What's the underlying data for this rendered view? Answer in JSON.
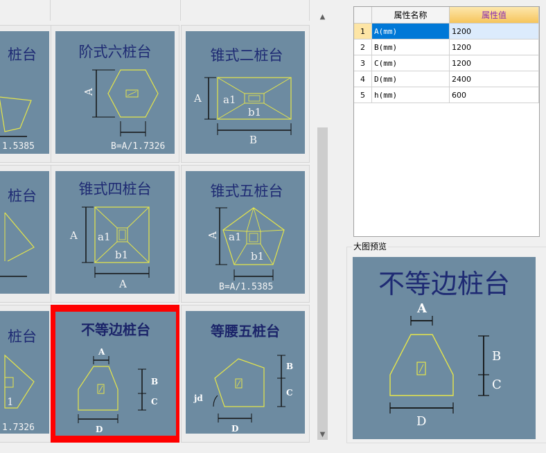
{
  "gallery": {
    "tiles": [
      {
        "title": "",
        "caption": "1.5385",
        "label_a": "",
        "label_b": ""
      },
      {
        "title": "阶式六桩台",
        "caption": "B=A/1.7326",
        "label_a": "A",
        "label_b": ""
      },
      {
        "title": "锥式二桩台",
        "caption": "B",
        "label_a": "A",
        "label_b": "a1",
        "label_c": "b1"
      },
      {
        "title": "",
        "caption": "",
        "label_a": "",
        "label_b": ""
      },
      {
        "title": "锥式四桩台",
        "caption": "A",
        "label_a": "A",
        "label_b": "a1",
        "label_c": "b1"
      },
      {
        "title": "锥式五桩台",
        "caption": "B=A/1.5385",
        "label_a": "A",
        "label_b": "a1",
        "label_c": "b1"
      },
      {
        "title": "",
        "caption": "1.7326",
        "label_a": "",
        "label_b": "1"
      },
      {
        "title": "不等边桩台",
        "caption": "D",
        "label_a": "A",
        "label_b": "B",
        "label_c": "C",
        "selected": true
      },
      {
        "title": "等腰五桩台",
        "caption": "D",
        "label_a": "jd",
        "label_b": "B",
        "label_c": "C"
      }
    ],
    "partial_title_char": "桩台"
  },
  "scrollbar": {
    "up": "▲",
    "down": "▼"
  },
  "properties": {
    "header": {
      "name": "属性名称",
      "value": "属性值"
    },
    "rows": [
      {
        "index": "1",
        "name": "A(mm)",
        "value": "1200",
        "selected": true
      },
      {
        "index": "2",
        "name": "B(mm)",
        "value": "1200"
      },
      {
        "index": "3",
        "name": "C(mm)",
        "value": "1200"
      },
      {
        "index": "4",
        "name": "D(mm)",
        "value": "2400"
      },
      {
        "index": "5",
        "name": "h(mm)",
        "value": "600"
      }
    ]
  },
  "preview": {
    "legend": "大图预览",
    "title": "不等边桩台",
    "label_a": "A",
    "label_b": "B",
    "label_c": "C",
    "label_d": "D"
  },
  "colors": {
    "panel": "#6d8ba1",
    "title": "#1e2a73",
    "line": "#e6e64a",
    "selected_border": "#ff0000",
    "header_value": "#8b2bb0"
  }
}
